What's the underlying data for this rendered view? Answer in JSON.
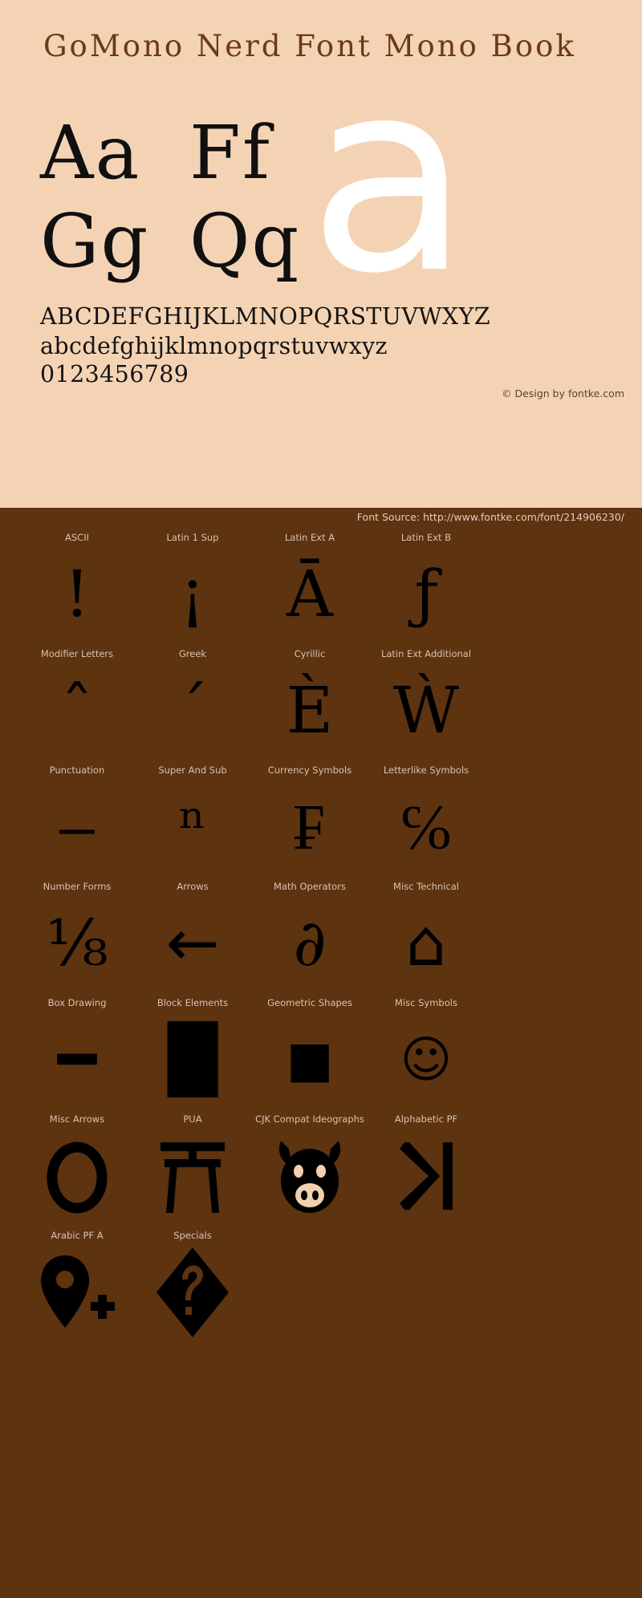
{
  "theme": {
    "panel_bg": "#F4D3B4",
    "page_bg": "#5E3310",
    "title_color": "#6B3A18",
    "glyph_color": "#000000",
    "big_glyph_color": "#FFFFFF",
    "label_color": "#D7C3B2"
  },
  "specimen": {
    "font_title": "GoMono Nerd Font Mono Book",
    "pairs": [
      {
        "id": "aa",
        "text": "Aa"
      },
      {
        "id": "ff",
        "text": "Ff"
      },
      {
        "id": "gg",
        "text": "Gg"
      },
      {
        "id": "qq",
        "text": "Qq"
      }
    ],
    "big_glyph": "a",
    "alphabet_upper": "ABCDEFGHIJKLMNOPQRSTUVWXYZ",
    "alphabet_lower": "abcdefghijklmnopqrstuvwxyz",
    "digits": "0123456789",
    "copyright": "© Design by fontke.com"
  },
  "source": {
    "label": "Font Source: http://www.fontke.com/font/214906230/"
  },
  "blocks": [
    [
      {
        "label": "ASCII",
        "glyph": "!",
        "style": "serif"
      },
      {
        "label": "Latin 1 Sup",
        "glyph": "¡",
        "style": "serif"
      },
      {
        "label": "Latin Ext A",
        "glyph": "Ā",
        "style": "serif"
      },
      {
        "label": "Latin Ext B",
        "glyph": "ƒ",
        "style": "serif"
      }
    ],
    [
      {
        "label": "Modifier Letters",
        "glyph": "ˆ",
        "style": "serif"
      },
      {
        "label": "Greek",
        "glyph": "΄",
        "style": "serif"
      },
      {
        "label": "Cyrillic",
        "glyph": "Ѐ",
        "style": "serif"
      },
      {
        "label": "Latin Ext Additional",
        "glyph": "Ẁ",
        "style": "serif"
      }
    ],
    [
      {
        "label": "Punctuation",
        "glyph": "‒",
        "style": "serif"
      },
      {
        "label": "Super And Sub",
        "glyph": "ⁿ",
        "style": "serif"
      },
      {
        "label": "Currency Symbols",
        "glyph": "₣",
        "style": "serif"
      },
      {
        "label": "Letterlike Symbols",
        "glyph": "℅",
        "style": "serif"
      }
    ],
    [
      {
        "label": "Number Forms",
        "glyph": "⅛",
        "style": "serif"
      },
      {
        "label": "Arrows",
        "glyph": "←",
        "style": "sans"
      },
      {
        "label": "Math Operators",
        "glyph": "∂",
        "style": "serif"
      },
      {
        "label": "Misc Technical",
        "glyph": "⌂",
        "style": "sans"
      }
    ],
    [
      {
        "label": "Box Drawing",
        "glyph": "━",
        "style": "sans"
      },
      {
        "label": "Block Elements",
        "glyph": "█",
        "style": "sans"
      },
      {
        "label": "Geometric Shapes",
        "glyph": "■",
        "style": "sans-small"
      },
      {
        "label": "Misc Symbols",
        "glyph": "☺",
        "style": "sans-small"
      }
    ],
    [
      {
        "label": "Misc Arrows",
        "glyph": "⭘",
        "style": "svg-circle"
      },
      {
        "label": "PUA",
        "glyph": "⛩",
        "style": "svg-torii"
      },
      {
        "label": "CJK Compat Ideographs",
        "glyph": "pig-face",
        "style": "svg-pig"
      },
      {
        "label": "Alphabetic PF",
        "glyph": "⏭",
        "style": "svg-skipend"
      }
    ],
    [
      {
        "label": "Arabic PF A",
        "glyph": "map-pin-plus",
        "style": "svg-pin"
      },
      {
        "label": "Specials",
        "glyph": "�",
        "style": "svg-replacement"
      },
      {
        "label": "",
        "glyph": "",
        "style": "empty"
      },
      {
        "label": "",
        "glyph": "",
        "style": "empty"
      }
    ]
  ]
}
